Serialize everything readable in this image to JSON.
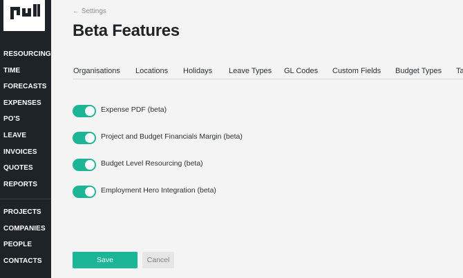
{
  "sidebar": {
    "logo_icon": "pm-logo-icon",
    "primary_items": [
      {
        "label": "RESOURCING"
      },
      {
        "label": "TIME"
      },
      {
        "label": "FORECASTS"
      },
      {
        "label": "EXPENSES"
      },
      {
        "label": "PO'S"
      },
      {
        "label": "LEAVE"
      },
      {
        "label": "INVOICES"
      },
      {
        "label": "QUOTES"
      },
      {
        "label": "REPORTS"
      }
    ],
    "secondary_items": [
      {
        "label": "PROJECTS"
      },
      {
        "label": "COMPANIES"
      },
      {
        "label": "PEOPLE"
      },
      {
        "label": "CONTACTS"
      }
    ]
  },
  "main": {
    "breadcrumb": "← Settings",
    "title": "Beta Features",
    "tabs": [
      {
        "label": "Organisations"
      },
      {
        "label": "Locations"
      },
      {
        "label": "Holidays"
      },
      {
        "label": "Leave Types"
      },
      {
        "label": "GL Codes"
      },
      {
        "label": "Custom Fields"
      },
      {
        "label": "Budget Types"
      },
      {
        "label": "Ta"
      }
    ],
    "features": [
      {
        "label": "Expense PDF (beta)",
        "enabled": true
      },
      {
        "label": "Project and Budget Financials Margin (beta)",
        "enabled": true
      },
      {
        "label": "Budget Level Resourcing (beta)",
        "enabled": true
      },
      {
        "label": "Employment Hero Integration (beta)",
        "enabled": true
      }
    ],
    "save_label": "Save",
    "cancel_label": "Cancel"
  },
  "colors": {
    "sidebar_bg": "#1d2327",
    "accent": "#1bb696",
    "page_bg": "#f4f4f4"
  }
}
